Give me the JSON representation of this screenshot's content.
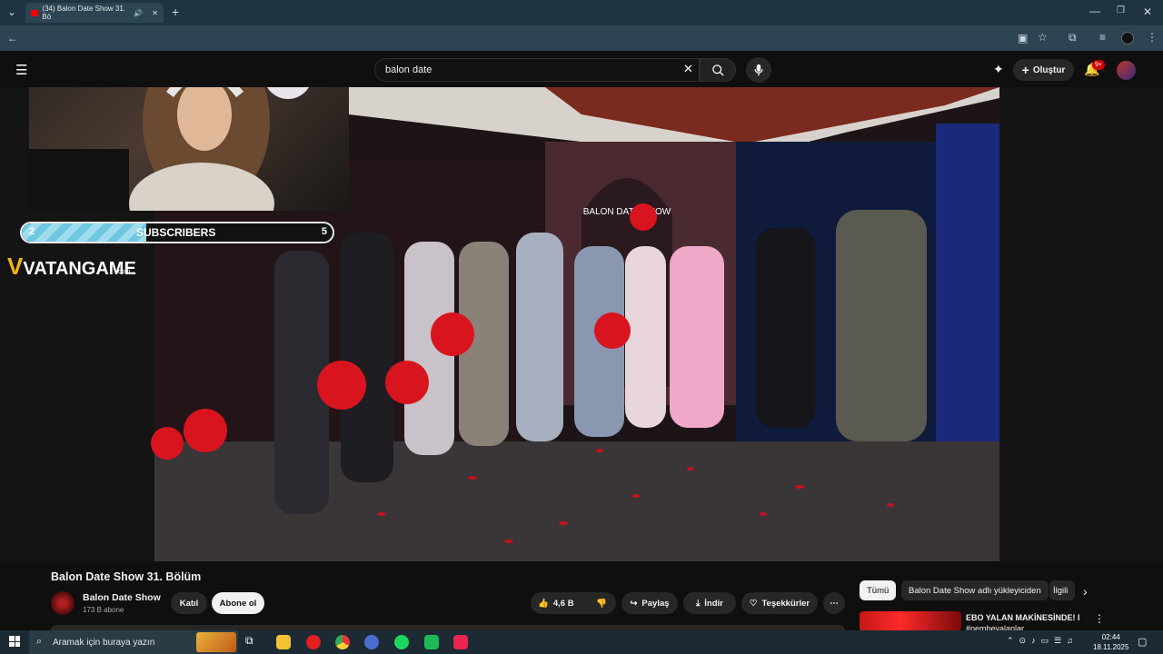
{
  "browser": {
    "tab_title": "(34) Balon Date Show 31. Bö",
    "new_tab": "+",
    "window_controls": [
      "minimize-icon",
      "restore-icon",
      "close-icon"
    ]
  },
  "youtube": {
    "search_value": "balon date",
    "create_label": "Oluştur",
    "notification_badge": "9+",
    "video": {
      "title": "Balon Date Show 31. Bölüm",
      "channel": "Balon Date Show",
      "subscribers": "173 B abone",
      "join_label": "Katıl",
      "subscribe_label": "Abone ol",
      "likes": "4,6 B",
      "share_label": "Paylaş",
      "download_label": "İndir",
      "thanks_label": "Teşekkürler"
    },
    "chips": [
      "Tümü",
      "Balon Date Show adlı yükleyiciden",
      "İlgili"
    ],
    "recommended": {
      "title": "EBO YALAN MAKİNESİNDE! l",
      "subtitle": "#pembeyalanlar"
    }
  },
  "overlay": {
    "sub_goal_current": "2",
    "sub_goal_label": "SUBSCRIBERS",
    "sub_goal_target": "5",
    "sub_goal_progress": 0.4,
    "brand": "VATANGAME",
    "brand_suffix": ".com",
    "balloon_text": "BALON DATE SHOW"
  },
  "taskbar": {
    "search_placeholder": "Aramak için buraya yazın",
    "time": "02:44",
    "date": "18.11.2025"
  },
  "colors": {
    "youtube_red": "#ff0000",
    "brand_yellow": "#f6b318",
    "goal_fill": "#6ec8e0"
  }
}
